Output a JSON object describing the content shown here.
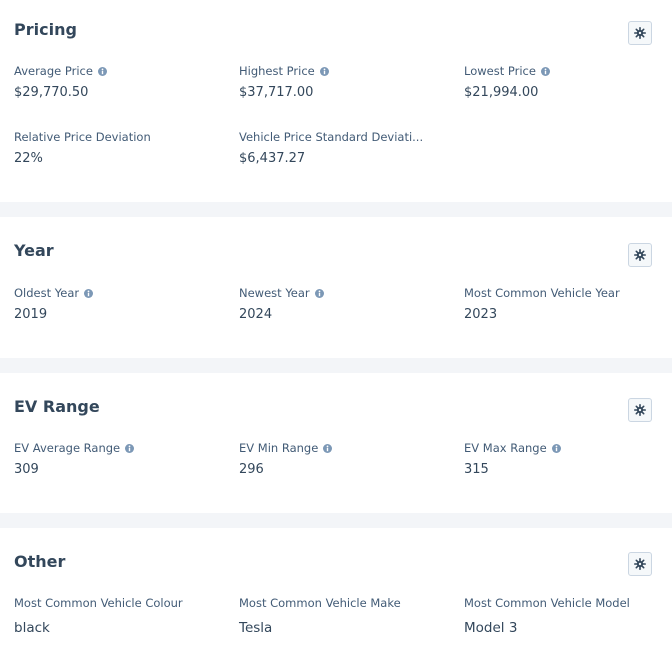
{
  "sections": [
    {
      "title": "Pricing",
      "metrics": [
        {
          "label": "Average Price",
          "value": "$29,770.50",
          "info": true
        },
        {
          "label": "Highest Price",
          "value": "$37,717.00",
          "info": true
        },
        {
          "label": "Lowest Price",
          "value": "$21,994.00",
          "info": true
        },
        {
          "label": "Relative Price Deviation",
          "value": "22%",
          "info": false
        },
        {
          "label": "Vehicle Price Standard Deviati...",
          "value": "$6,437.27",
          "info": false
        }
      ]
    },
    {
      "title": "Year",
      "metrics": [
        {
          "label": "Oldest Year",
          "value": "2019",
          "info": true
        },
        {
          "label": "Newest Year",
          "value": "2024",
          "info": true
        },
        {
          "label": "Most Common Vehicle Year",
          "value": "2023",
          "info": false
        }
      ]
    },
    {
      "title": "EV Range",
      "metrics": [
        {
          "label": "EV Average Range",
          "value": "309",
          "info": true
        },
        {
          "label": "EV Min Range",
          "value": "296",
          "info": true
        },
        {
          "label": "EV Max Range",
          "value": "315",
          "info": true
        }
      ]
    },
    {
      "title": "Other",
      "metrics": [
        {
          "label": "Most Common Vehicle Colour",
          "value": "black",
          "info": false
        },
        {
          "label": "Most Common Vehicle Make",
          "value": "Tesla",
          "info": false
        },
        {
          "label": "Most Common Vehicle Model",
          "value": "Model 3",
          "info": false
        }
      ]
    }
  ],
  "icons": {
    "settings": "gear-icon",
    "info": "info-icon"
  },
  "colors": {
    "page_background": "#f3f5f8",
    "card_background": "#ffffff",
    "title_text": "#33475b",
    "label_text": "#425b76",
    "info_icon": "#7c98b6",
    "button_border": "#cbd6e2"
  }
}
